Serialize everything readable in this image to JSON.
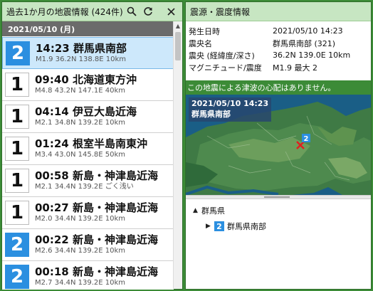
{
  "left": {
    "title": "過去1か月の地震情報 (424件)",
    "date_header": "2021/05/10 (月)",
    "icons": [
      "search-icon",
      "refresh-icon",
      "close-icon"
    ],
    "items": [
      {
        "scale": "2",
        "line1": "14:23 群馬県南部",
        "line2": "M1.9 36.2N 138.8E 10km"
      },
      {
        "scale": "1",
        "line1": "09:40 北海道東方沖",
        "line2": "M4.8 43.2N 147.1E 40km"
      },
      {
        "scale": "1",
        "line1": "04:14 伊豆大島近海",
        "line2": "M2.1 34.8N 139.2E 10km"
      },
      {
        "scale": "1",
        "line1": "01:24 根室半島南東沖",
        "line2": "M3.4 43.0N 145.8E 50km"
      },
      {
        "scale": "1",
        "line1": "00:58 新島・神津島近海",
        "line2": "M2.1 34.4N 139.2E ごく浅い"
      },
      {
        "scale": "1",
        "line1": "00:27 新島・神津島近海",
        "line2": "M2.0 34.4N 139.2E 10km"
      },
      {
        "scale": "2",
        "line1": "00:22 新島・神津島近海",
        "line2": "M2.6 34.4N 139.2E 10km"
      },
      {
        "scale": "2",
        "line1": "00:18 新島・神津島近海",
        "line2": "M2.7 34.4N 139.2E 10km"
      }
    ]
  },
  "right": {
    "title": "震源・震度情報",
    "info": [
      {
        "label": "発生日時",
        "value": "2021/05/10 14:23"
      },
      {
        "label": "震央名",
        "value": "群馬県南部 (321)"
      },
      {
        "label": "震央 (経緯度/深さ)",
        "value": "36.2N 139.0E 10km"
      },
      {
        "label": "マグニチュード/震度",
        "value": "M1.9 最大 2"
      }
    ],
    "tsunami": "この地震による津波の心配はありません。",
    "map_label_time": "2021/05/10 14:23",
    "map_label_place": "群馬県南部",
    "map_marker_scale": "2",
    "tree_pref": "群馬県",
    "tree_area": "群馬県南部",
    "tree_area_scale": "2"
  },
  "colors": {
    "frame_green": "#3c8b37",
    "header_green": "#c7e6c2",
    "scale2_blue": "#2b8fe0",
    "selected_bg": "#cde8fb"
  }
}
